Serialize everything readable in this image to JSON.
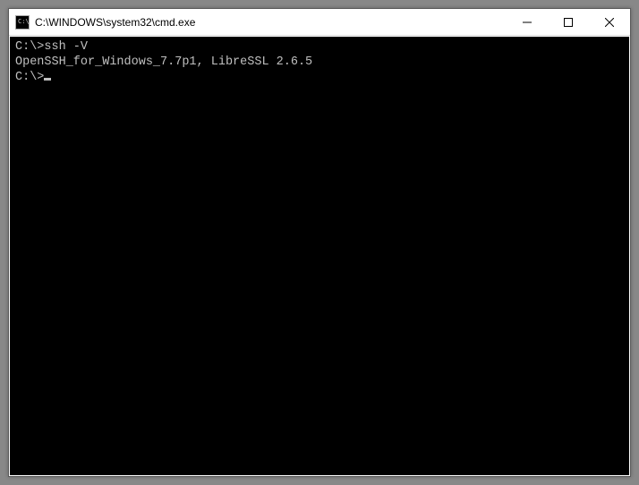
{
  "titlebar": {
    "title": "C:\\WINDOWS\\system32\\cmd.exe"
  },
  "terminal": {
    "line1": "C:\\>ssh -V",
    "line2": "OpenSSH_for_Windows_7.7p1, LibreSSL 2.6.5",
    "blank": "",
    "prompt": "C:\\>"
  }
}
